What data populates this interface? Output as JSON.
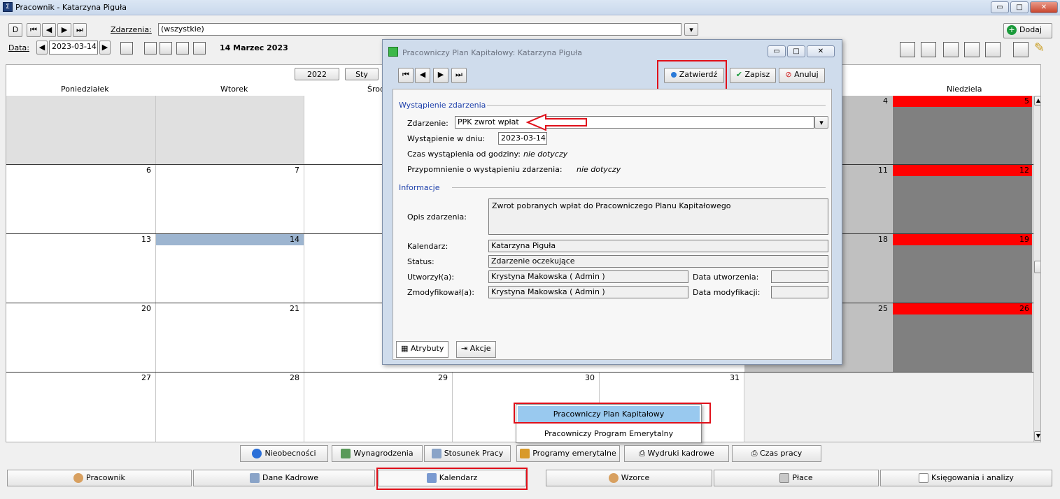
{
  "window": {
    "title": "Pracownik - Katarzyna Piguła",
    "min": "▭",
    "max": "□",
    "close": "✕"
  },
  "toolbar": {
    "nav_first": "D",
    "zdarzenia_label": "Zdarzenia:",
    "zdarzenia_value": "(wszystkie)",
    "data_label": "Data:",
    "date_value": "2023-03-14",
    "date_display": "14 Marzec 2023",
    "dodaj": "Dodaj",
    "year": "2022",
    "month": "Sty"
  },
  "calendar": {
    "headers": [
      "Poniedziałek",
      "Wtorek",
      "Środa",
      "Niedziela"
    ],
    "rows": [
      {
        "cells": [
          "",
          "",
          "",
          "4",
          "5"
        ]
      },
      {
        "cells": [
          "6",
          "7",
          "",
          "11",
          "12"
        ]
      },
      {
        "cells": [
          "13",
          "14",
          "",
          "18",
          "19"
        ]
      },
      {
        "cells": [
          "20",
          "21",
          "",
          "25",
          "26"
        ]
      },
      {
        "cells": [
          "27",
          "28",
          "29",
          "30",
          "31"
        ]
      }
    ]
  },
  "dialog": {
    "title": "Pracowniczy Plan Kapitałowy:  Katarzyna Piguła",
    "zatwierdz": "Zatwierdź",
    "zapisz": "Zapisz",
    "anuluj": "Anuluj",
    "sect1": "Wystąpienie zdarzenia",
    "zdarzenie_label": "Zdarzenie:",
    "zdarzenie_value": "PPK zwrot wpłat",
    "wyst_label": "Wystąpienie w dniu:",
    "wyst_value": "2023-03-14",
    "czas_label": "Czas wystąpienia od godziny:",
    "czas_value": "nie dotyczy",
    "przyp_label": "Przypomnienie o wystąpieniu zdarzenia:",
    "przyp_value": "nie dotyczy",
    "sect2": "Informacje",
    "opis_label": "Opis zdarzenia:",
    "opis_value": "Zwrot pobranych wpłat do Pracowniczego Planu Kapitałowego",
    "kal_label": "Kalendarz:",
    "kal_value": "Katarzyna Piguła",
    "status_label": "Status:",
    "status_value": "Zdarzenie oczekujące",
    "utw_label": "Utworzył(a):",
    "utw_value": "Krystyna Makowska ( Admin )",
    "data_utw_label": "Data utworzenia:",
    "zmod_label": "Zmodyfikował(a):",
    "zmod_value": "Krystyna Makowska ( Admin )",
    "data_mod_label": "Data modyfikacji:",
    "tab_atrybuty": "Atrybuty",
    "tab_akcje": "Akcje"
  },
  "menu": {
    "item1": "Pracowniczy Plan Kapitałowy",
    "item2": "Pracowniczy Program Emerytalny"
  },
  "bottom_tabs": [
    "Nieobecności",
    "Wynagrodzenia",
    "Stosunek Pracy",
    "Programy emerytalne",
    "Wydruki kadrowe",
    "Czas pracy"
  ],
  "nav_tabs": [
    "Pracownik",
    "Dane Kadrowe",
    "Kalendarz",
    "Wzorce",
    "Płace",
    "Księgowania i analizy"
  ]
}
